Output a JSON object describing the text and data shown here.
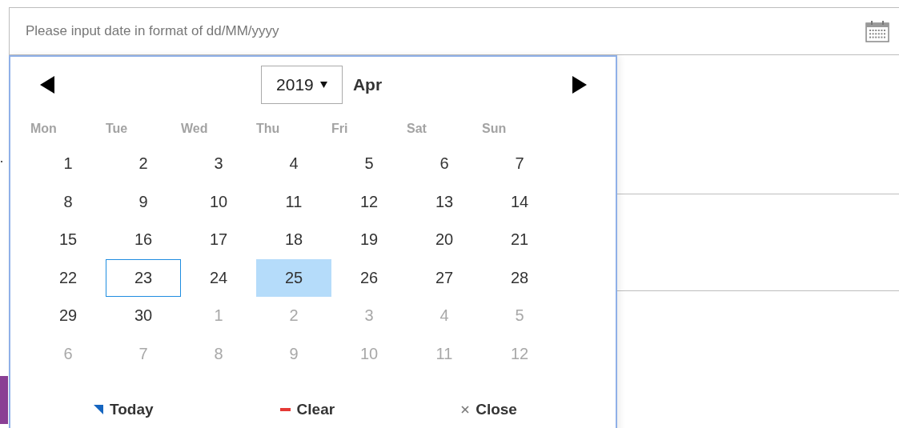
{
  "date_field": {
    "placeholder": "Please input date in format of dd/MM/yyyy"
  },
  "calendar": {
    "year": "2019",
    "month": "Apr",
    "weekdays": [
      "Mon",
      "Tue",
      "Wed",
      "Thu",
      "Fri",
      "Sat",
      "Sun"
    ],
    "weeks": [
      [
        {
          "label": "1",
          "muted": false,
          "today": false,
          "selected": false
        },
        {
          "label": "2",
          "muted": false,
          "today": false,
          "selected": false
        },
        {
          "label": "3",
          "muted": false,
          "today": false,
          "selected": false
        },
        {
          "label": "4",
          "muted": false,
          "today": false,
          "selected": false
        },
        {
          "label": "5",
          "muted": false,
          "today": false,
          "selected": false
        },
        {
          "label": "6",
          "muted": false,
          "today": false,
          "selected": false
        },
        {
          "label": "7",
          "muted": false,
          "today": false,
          "selected": false
        }
      ],
      [
        {
          "label": "8",
          "muted": false,
          "today": false,
          "selected": false
        },
        {
          "label": "9",
          "muted": false,
          "today": false,
          "selected": false
        },
        {
          "label": "10",
          "muted": false,
          "today": false,
          "selected": false
        },
        {
          "label": "11",
          "muted": false,
          "today": false,
          "selected": false
        },
        {
          "label": "12",
          "muted": false,
          "today": false,
          "selected": false
        },
        {
          "label": "13",
          "muted": false,
          "today": false,
          "selected": false
        },
        {
          "label": "14",
          "muted": false,
          "today": false,
          "selected": false
        }
      ],
      [
        {
          "label": "15",
          "muted": false,
          "today": false,
          "selected": false
        },
        {
          "label": "16",
          "muted": false,
          "today": false,
          "selected": false
        },
        {
          "label": "17",
          "muted": false,
          "today": false,
          "selected": false
        },
        {
          "label": "18",
          "muted": false,
          "today": false,
          "selected": false
        },
        {
          "label": "19",
          "muted": false,
          "today": false,
          "selected": false
        },
        {
          "label": "20",
          "muted": false,
          "today": false,
          "selected": false
        },
        {
          "label": "21",
          "muted": false,
          "today": false,
          "selected": false
        }
      ],
      [
        {
          "label": "22",
          "muted": false,
          "today": false,
          "selected": false
        },
        {
          "label": "23",
          "muted": false,
          "today": true,
          "selected": false
        },
        {
          "label": "24",
          "muted": false,
          "today": false,
          "selected": false
        },
        {
          "label": "25",
          "muted": false,
          "today": false,
          "selected": true
        },
        {
          "label": "26",
          "muted": false,
          "today": false,
          "selected": false
        },
        {
          "label": "27",
          "muted": false,
          "today": false,
          "selected": false
        },
        {
          "label": "28",
          "muted": false,
          "today": false,
          "selected": false
        }
      ],
      [
        {
          "label": "29",
          "muted": false,
          "today": false,
          "selected": false
        },
        {
          "label": "30",
          "muted": false,
          "today": false,
          "selected": false
        },
        {
          "label": "1",
          "muted": true,
          "today": false,
          "selected": false
        },
        {
          "label": "2",
          "muted": true,
          "today": false,
          "selected": false
        },
        {
          "label": "3",
          "muted": true,
          "today": false,
          "selected": false
        },
        {
          "label": "4",
          "muted": true,
          "today": false,
          "selected": false
        },
        {
          "label": "5",
          "muted": true,
          "today": false,
          "selected": false
        }
      ],
      [
        {
          "label": "6",
          "muted": true,
          "today": false,
          "selected": false
        },
        {
          "label": "7",
          "muted": true,
          "today": false,
          "selected": false
        },
        {
          "label": "8",
          "muted": true,
          "today": false,
          "selected": false
        },
        {
          "label": "9",
          "muted": true,
          "today": false,
          "selected": false
        },
        {
          "label": "10",
          "muted": true,
          "today": false,
          "selected": false
        },
        {
          "label": "11",
          "muted": true,
          "today": false,
          "selected": false
        },
        {
          "label": "12",
          "muted": true,
          "today": false,
          "selected": false
        }
      ]
    ],
    "footer": [
      {
        "kind": "today",
        "label": "Today"
      },
      {
        "kind": "clear",
        "label": "Clear"
      },
      {
        "kind": "close",
        "label": "Close"
      }
    ]
  }
}
